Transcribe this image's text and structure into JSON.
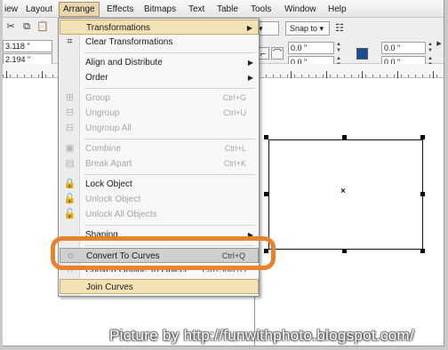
{
  "menubar": {
    "items": [
      {
        "label": "iew"
      },
      {
        "label": "Layout"
      },
      {
        "label": "Arrange"
      },
      {
        "label": "Effects"
      },
      {
        "label": "Bitmaps"
      },
      {
        "label": "Text"
      },
      {
        "label": "Table"
      },
      {
        "label": "Tools"
      },
      {
        "label": "Window"
      },
      {
        "label": "Help"
      }
    ]
  },
  "propbar": {
    "x_value": "3.118 \"",
    "y_value": "2.194 \"",
    "snap_to_label": "Snap to",
    "corner_fields": [
      "0.0 \"",
      "0.0 \"",
      "0.0 \"",
      "0.0 \""
    ],
    "icons": [
      "cut-icon",
      "copy-icon",
      "paste-icon",
      "node-edit-icon",
      "gear-icon",
      "lock-icon"
    ]
  },
  "arrange_menu": {
    "items": [
      {
        "label": "Transformations",
        "icon": "",
        "shortcut": "",
        "submenu": true,
        "state": "highlighted"
      },
      {
        "label": "Clear Transformations",
        "icon": "clear-transform-icon",
        "shortcut": "",
        "submenu": false,
        "state": "enabled"
      },
      {
        "label": "Align and Distribute",
        "icon": "",
        "shortcut": "",
        "submenu": true,
        "state": "enabled"
      },
      {
        "label": "Order",
        "icon": "",
        "shortcut": "",
        "submenu": true,
        "state": "enabled"
      },
      {
        "label": "Group",
        "icon": "group-icon",
        "shortcut": "Ctrl+G",
        "submenu": false,
        "state": "disabled"
      },
      {
        "label": "Ungroup",
        "icon": "ungroup-icon",
        "shortcut": "Ctrl+U",
        "submenu": false,
        "state": "disabled"
      },
      {
        "label": "Ungroup All",
        "icon": "ungroup-all-icon",
        "shortcut": "",
        "submenu": false,
        "state": "disabled"
      },
      {
        "label": "Combine",
        "icon": "combine-icon",
        "shortcut": "Ctrl+L",
        "submenu": false,
        "state": "disabled"
      },
      {
        "label": "Break Apart",
        "icon": "break-apart-icon",
        "shortcut": "Ctrl+K",
        "submenu": false,
        "state": "disabled"
      },
      {
        "label": "Lock Object",
        "icon": "lock-icon",
        "shortcut": "",
        "submenu": false,
        "state": "enabled"
      },
      {
        "label": "Unlock Object",
        "icon": "unlock-icon",
        "shortcut": "",
        "submenu": false,
        "state": "disabled"
      },
      {
        "label": "Unlock All Objects",
        "icon": "unlock-all-icon",
        "shortcut": "",
        "submenu": false,
        "state": "disabled"
      },
      {
        "label": "Shaping",
        "icon": "",
        "shortcut": "",
        "submenu": true,
        "state": "enabled"
      },
      {
        "label": "Convert To Curves",
        "icon": "convert-curves-icon",
        "shortcut": "Ctrl+Q",
        "submenu": false,
        "state": "selected"
      },
      {
        "label": "Convert Outline To Object",
        "icon": "outline-object-icon",
        "shortcut": "Ctrl+Shift+Q",
        "submenu": false,
        "state": "enabled"
      },
      {
        "label": "Join Curves",
        "icon": "",
        "shortcut": "",
        "submenu": false,
        "state": "highlighted"
      }
    ]
  },
  "colors": {
    "annotation": "#e9822a",
    "menu_highlight": "#f3e2b5",
    "menu_selected": "#cfcfcf"
  },
  "watermark": "Picture by http://funwithphoto.blogspot.com/"
}
